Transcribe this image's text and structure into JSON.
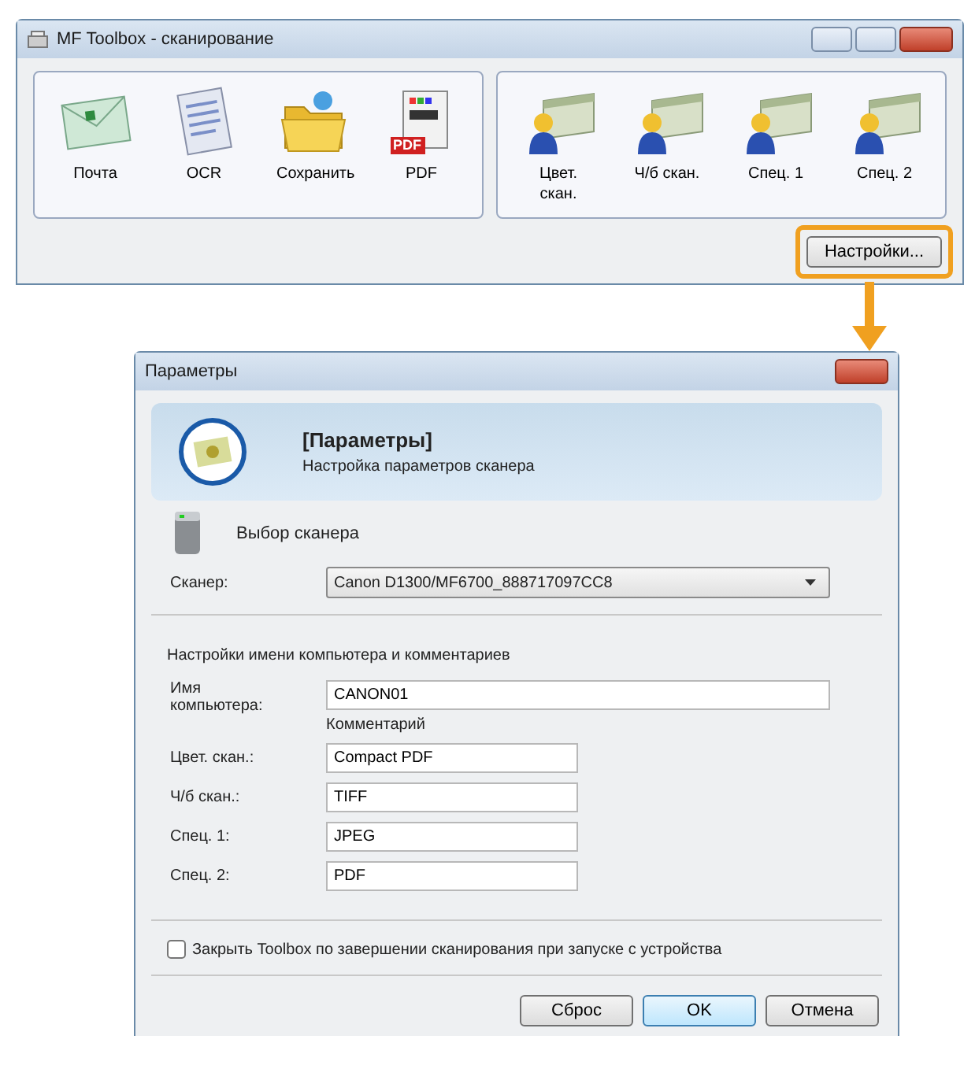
{
  "toolbox": {
    "title": "MF Toolbox - сканирование",
    "groups": [
      {
        "buttons": [
          {
            "label": "Почта",
            "kind": "mail"
          },
          {
            "label": "OCR",
            "kind": "document"
          },
          {
            "label": "Сохранить",
            "kind": "folder"
          },
          {
            "label": "PDF",
            "kind": "pdf",
            "badge": "PDF"
          }
        ]
      },
      {
        "buttons": [
          {
            "label": "Цвет. скан.",
            "kind": "person"
          },
          {
            "label": "Ч/б скан.",
            "kind": "person"
          },
          {
            "label": "Спец. 1",
            "kind": "person"
          },
          {
            "label": "Спец. 2",
            "kind": "person"
          }
        ]
      }
    ],
    "settings_button": {
      "label": "Настройки...",
      "highlighted": true
    }
  },
  "dialog": {
    "title": "Параметры",
    "header": {
      "title": "[Параметры]",
      "subtitle": "Настройка параметров сканера"
    },
    "scanner": {
      "section_label": "Выбор сканера",
      "field_label": "Сканер:",
      "value": "Canon D1300/MF6700_888717097CC8"
    },
    "names": {
      "heading": "Настройки имени компьютера и комментариев",
      "computer_label": "Имя компьютера:",
      "computer_value": "CANON01",
      "comment_heading": "Комментарий",
      "fields": [
        {
          "label": "Цвет. скан.:",
          "value": "Compact PDF"
        },
        {
          "label": "Ч/б скан.:",
          "value": "TIFF"
        },
        {
          "label": "Спец. 1:",
          "value": "JPEG"
        },
        {
          "label": "Спец. 2:",
          "value": "PDF"
        }
      ]
    },
    "close_checkbox": {
      "label": "Закрыть Toolbox по завершении сканирования при запуске с устройства",
      "checked": false
    },
    "buttons": [
      {
        "label": "Сброс",
        "default": false
      },
      {
        "label": "OK",
        "default": true
      },
      {
        "label": "Отмена",
        "default": false
      }
    ]
  }
}
